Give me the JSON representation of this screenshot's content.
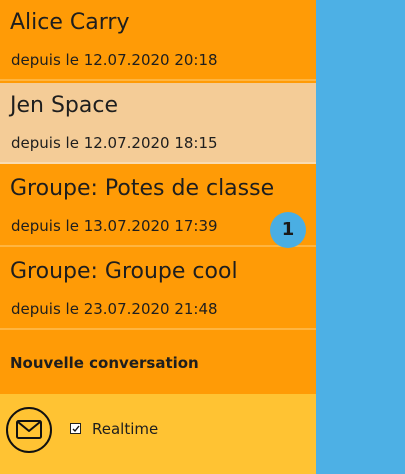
{
  "conversations": [
    {
      "name": "Alice Carry",
      "date": "depuis le 12.07.2020 20:18",
      "selected": false
    },
    {
      "name": "Jen Space",
      "date": "depuis le 12.07.2020 18:15",
      "selected": true
    },
    {
      "name": "Groupe: Potes de classe",
      "date": "depuis le 13.07.2020 17:39",
      "unread": "1"
    },
    {
      "name": "Groupe: Groupe cool",
      "date": "depuis le 23.07.2020 21:48"
    }
  ],
  "new_conversation_label": "Nouvelle conversation",
  "footer": {
    "mail_icon": "envelope-icon",
    "realtime_label": "Realtime",
    "realtime_checked": true
  },
  "colors": {
    "sidebar": "#ff9b06",
    "selected": "#f4cc97",
    "footer": "#ffc333",
    "main": "#4db0e5",
    "badge": "#4aaee3"
  }
}
